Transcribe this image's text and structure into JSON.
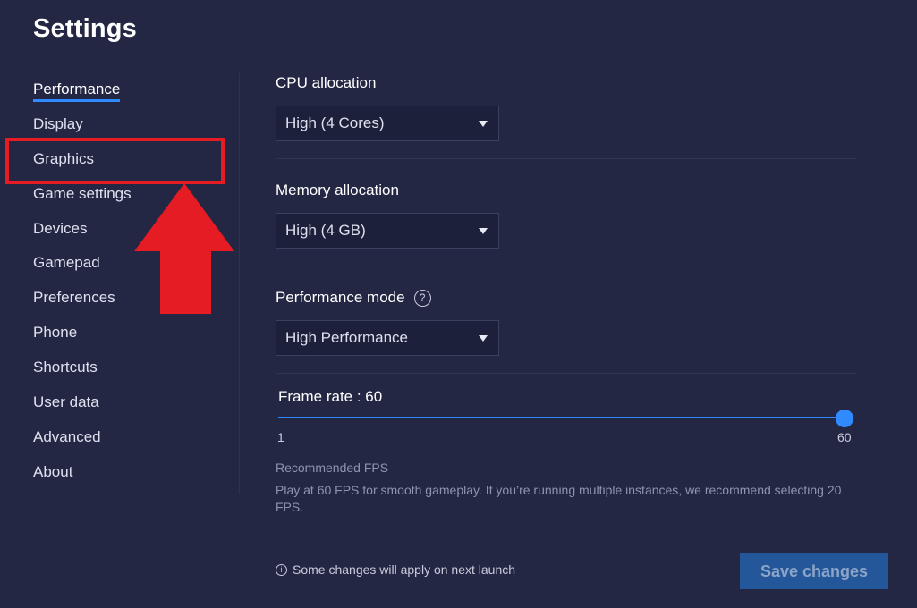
{
  "header": {
    "title": "Settings"
  },
  "sidebar": {
    "items": [
      {
        "label": "Performance"
      },
      {
        "label": "Display"
      },
      {
        "label": "Graphics"
      },
      {
        "label": "Game settings"
      },
      {
        "label": "Devices"
      },
      {
        "label": "Gamepad"
      },
      {
        "label": "Preferences"
      },
      {
        "label": "Phone"
      },
      {
        "label": "Shortcuts"
      },
      {
        "label": "User data"
      },
      {
        "label": "Advanced"
      },
      {
        "label": "About"
      }
    ],
    "active_index": 0
  },
  "performance": {
    "cpu": {
      "label": "CPU allocation",
      "value": "High (4 Cores)"
    },
    "memory": {
      "label": "Memory allocation",
      "value": "High (4 GB)"
    },
    "mode": {
      "label": "Performance mode",
      "value": "High Performance",
      "help_icon": "help-icon"
    },
    "frame_rate": {
      "label": "Frame rate : 60",
      "value": 60,
      "min_label": "1",
      "max_label": "60",
      "min": 1,
      "max": 60
    },
    "recommended_title": "Recommended FPS",
    "recommended_text": "Play at 60 FPS for smooth gameplay. If you’re running multiple instances, we recommend selecting 20 FPS."
  },
  "footer": {
    "note": "Some changes will apply on next launch",
    "info_icon": "info-icon",
    "save_label": "Save changes"
  },
  "colors": {
    "background": "#232743",
    "accent": "#2f8bff",
    "annotation_red": "#e51c24",
    "save_button_bg": "#24579a"
  }
}
